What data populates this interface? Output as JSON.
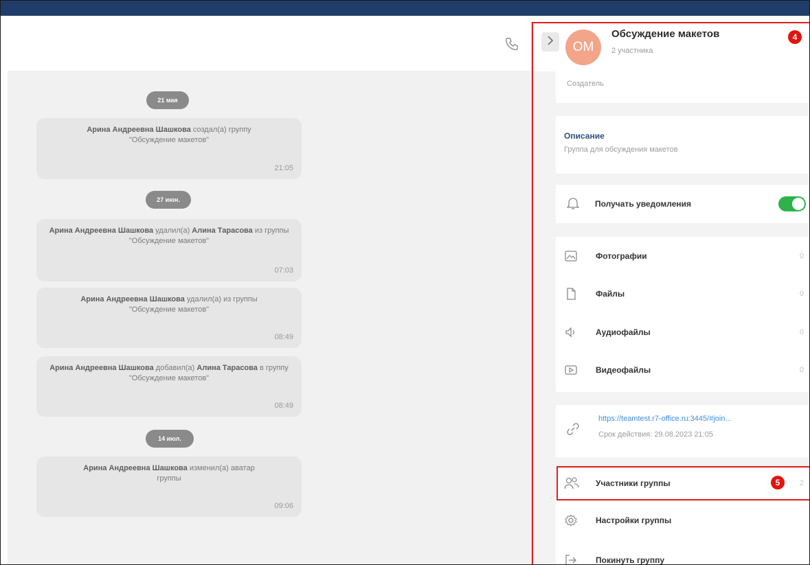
{
  "chat": {
    "dates": [
      "21 мая",
      "27 июн.",
      "14 июл."
    ],
    "messages": [
      {
        "author": "Арина Андреевна Шашкова",
        "action": " создал(а) группу",
        "rest": "\"Обсуждение макетов\"",
        "time": "21:05"
      },
      {
        "author": "Арина Андреевна Шашкова",
        "action": " удалил(а) ",
        "target": "Алина Тарасова",
        "rest": " из группы \"Обсуждение макетов\"",
        "time": "07:03"
      },
      {
        "author": "Арина Андреевна Шашкова",
        "action": " удалил(а) из группы",
        "rest": "\"Обсуждение макетов\"",
        "time": "08:49"
      },
      {
        "author": "Арина Андреевна Шашкова",
        "action": " добавил(а) ",
        "target": "Алина Тарасова",
        "rest": " в группу \"Обсуждение макетов\"",
        "time": "08:49"
      },
      {
        "author": "Арина Андреевна Шашкова",
        "action": " изменил(а) аватар",
        "rest": "группы",
        "time": "09:06"
      }
    ]
  },
  "panel": {
    "avatar_initials": "ОМ",
    "title": "Обсуждение макетов",
    "subtitle": "2 участника",
    "creator_label": "Создатель",
    "description_label": "Описание",
    "description_text": "Группа для обсуждения макетов",
    "notifications_label": "Получать уведомления",
    "notifications_on": true,
    "media": [
      {
        "label": "Фотографии",
        "count": "0",
        "icon": "photo-icon"
      },
      {
        "label": "Файлы",
        "count": "0",
        "icon": "file-icon"
      },
      {
        "label": "Аудиофайлы",
        "count": "0",
        "icon": "audio-icon"
      },
      {
        "label": "Видеофайлы",
        "count": "0",
        "icon": "video-icon"
      }
    ],
    "invite_link": "https://teamtest.r7-office.ru:3445/#join...",
    "invite_expiry": "Срок действия: 29.08.2023 21:05",
    "members_label": "Участники группы",
    "members_count": "2",
    "settings_label": "Настройки группы",
    "leave_label": "Покинуть группу"
  },
  "annotations": {
    "badge_header": "4",
    "badge_members": "5"
  },
  "colors": {
    "topbar": "#1f3d68",
    "accent_toggle": "#2eb24b",
    "annotation_red": "#e01c1c",
    "avatar": "#f3a58a",
    "link": "#3d8fe0"
  }
}
